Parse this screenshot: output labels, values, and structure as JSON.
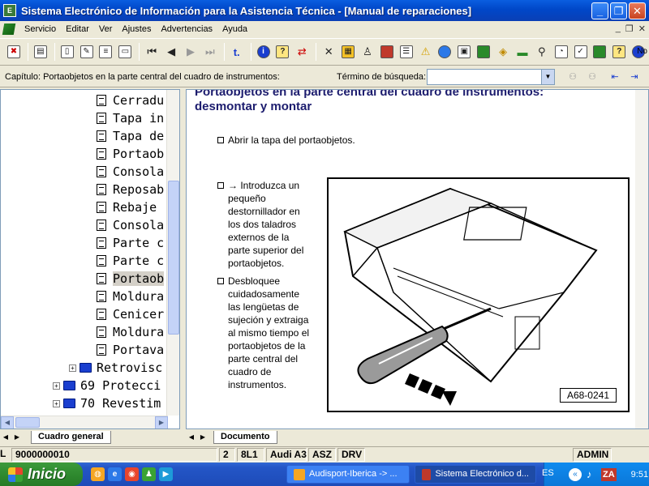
{
  "window": {
    "title": "Sistema Electrónico de Información para la Asistencia Técnica - [Manual de reparaciones]",
    "minimize": "_",
    "maximize": "❐",
    "close": "✕"
  },
  "menu": {
    "items": [
      "Servicio",
      "Editar",
      "Ver",
      "Ajustes",
      "Advertencias",
      "Ayuda"
    ],
    "mdi": [
      "_",
      "❐",
      "✕"
    ]
  },
  "toolbar": {
    "right_text": "No"
  },
  "search": {
    "chapter_text": "Capítulo: Portaobjetos en la parte central del cuadro de instrumentos:",
    "label": "Término de búsqueda:",
    "value": ""
  },
  "tree": {
    "items": [
      {
        "label": "Cerradu",
        "kind": "doc"
      },
      {
        "label": "Tapa in",
        "kind": "doc"
      },
      {
        "label": "Tapa de",
        "kind": "doc"
      },
      {
        "label": "Portaob",
        "kind": "doc"
      },
      {
        "label": "Consola",
        "kind": "doc"
      },
      {
        "label": "Reposab",
        "kind": "doc"
      },
      {
        "label": "Rebaje ",
        "kind": "doc"
      },
      {
        "label": "Consola",
        "kind": "doc"
      },
      {
        "label": "Parte c",
        "kind": "doc"
      },
      {
        "label": "Parte c",
        "kind": "doc"
      },
      {
        "label": "Portaob",
        "kind": "doc",
        "selected": true
      },
      {
        "label": "Moldura",
        "kind": "doc"
      },
      {
        "label": "Cenicer",
        "kind": "doc"
      },
      {
        "label": "Moldura",
        "kind": "doc"
      },
      {
        "label": "Portava",
        "kind": "doc"
      }
    ],
    "books": [
      {
        "label": "Retrovisc"
      },
      {
        "label": "69 Protecci"
      },
      {
        "label": "70 Revestim"
      }
    ],
    "tab_label": "Cuadro general"
  },
  "document": {
    "title_line1": "Portaobjetos en la parte central del cuadro de instrumentos:",
    "title_line2": "desmontar y montar",
    "step1": "Abrir la tapa del portaobjetos.",
    "step2": "→ Introduzca un pequeño destornillador en los dos taladros externos de la parte superior del portaobjetos.",
    "step3": "Desbloquee cuidadosamente las lengüetas de sujeción y extraiga al mismo tiempo el portaobjetos de la parte central del cuadro de instrumentos.",
    "figure_label": "A68-0241",
    "tab_label": "Documento"
  },
  "status": {
    "cells": [
      "L",
      "9000000010",
      "2",
      "8L1",
      "Audi A3",
      "ASZ",
      "DRV",
      "ADMIN"
    ]
  },
  "taskbar": {
    "start_label": "Inicio",
    "tasks": [
      "Audisport-Iberica -> ...",
      "Sistema Electrónico d..."
    ],
    "lang": "ES",
    "tray_badge": "ZA",
    "time": "9:51"
  }
}
